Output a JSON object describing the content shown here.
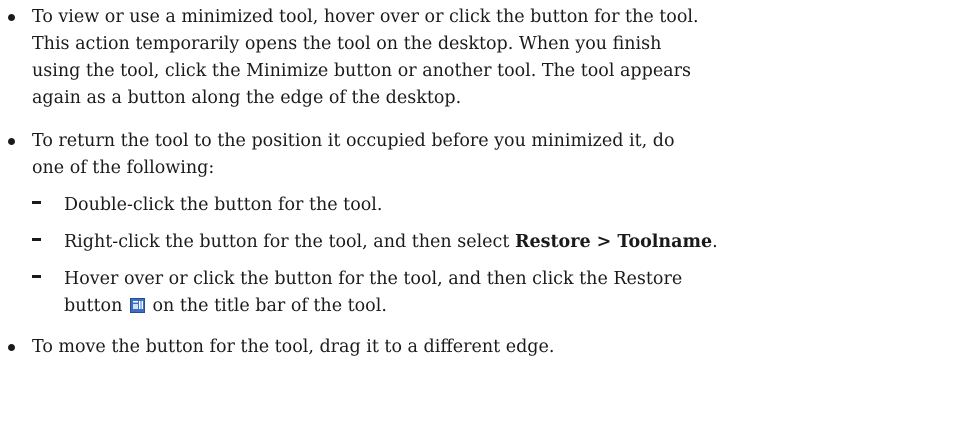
{
  "bullets": [
    {
      "lines": [
        "To view or use a minimized tool, hover over or click the button for the tool.",
        "This action temporarily opens the tool on the desktop. When you finish",
        "using the tool, click the Minimize button or another tool. The tool appears",
        "again as a button along the edge of the desktop."
      ]
    },
    {
      "lines": [
        "To return the tool to the position it occupied before you minimized it, do",
        "one of the following:"
      ],
      "sub_items": [
        {
          "text": "Double-click the button for the tool."
        },
        {
          "text_before": "Right-click the button for the tool, and then select ",
          "bold": "Restore > Toolname",
          "text_after": "."
        },
        {
          "line1": "Hover over or click the button for the tool, and then click the Restore",
          "line2_before": "button ",
          "line2_after": " on the title bar of the tool.",
          "icon": "restore-button-icon"
        }
      ]
    },
    {
      "lines": [
        "To move the button for the tool, drag it to a different edge."
      ]
    }
  ],
  "colors": {
    "text": "#1a1a1a",
    "icon_blue": "#3a6fc4",
    "icon_light": "#cfe0f7"
  }
}
